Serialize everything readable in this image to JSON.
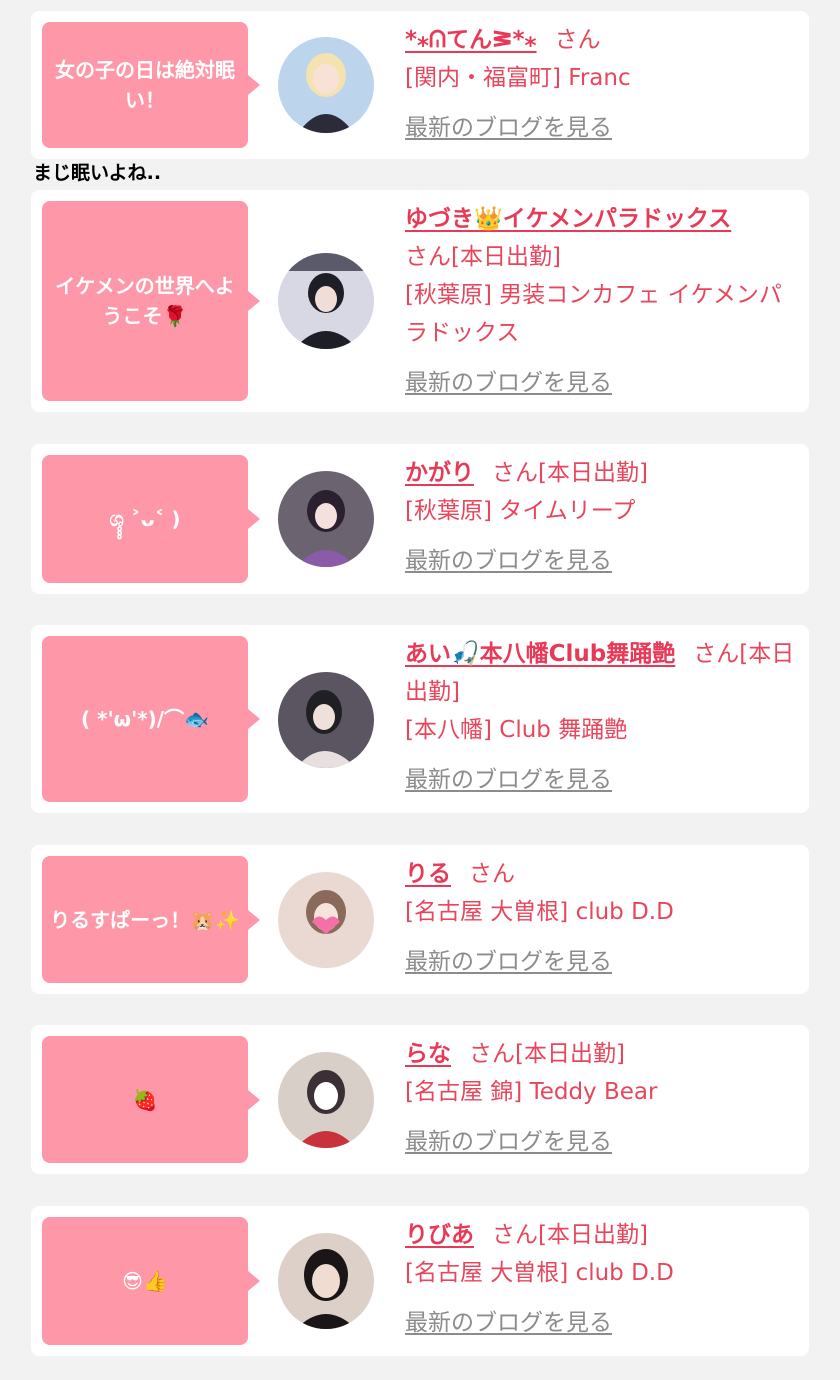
{
  "posts": [
    {
      "bubble": "女の子の日は絶対眠い！",
      "name": "*⁎ᕬてんᕒ*⁎",
      "suffix": "さん",
      "shop": "[関内・福富町] Franc",
      "blog_link": "最新のブログを見る",
      "avatar_colors": [
        "#bcd4ec",
        "#f4e3b0",
        "#2b2b3a"
      ]
    },
    {
      "bubble": "イケメンの世界へようこそ🌹",
      "name": "ゆづき👑イケメンパラドックス",
      "suffix": "さん[本日出勤]",
      "shop": "[秋葉原] 男装コンカフェ イケメンパラドックス",
      "blog_link": "最新のブログを見る",
      "avatar_colors": [
        "#1e1e26",
        "#d8d8e4",
        "#5a5a6a"
      ]
    },
    {
      "bubble": "ශ̥̥̥ ˃ᴗ˂ )",
      "name": "かがり",
      "suffix": "さん[本日出勤]",
      "shop": "[秋葉原] タイムリープ",
      "blog_link": "最新のブログを見る",
      "avatar_colors": [
        "#6b6470",
        "#2a2030",
        "#8b5aa8"
      ]
    },
    {
      "bubble": "( *'ω'*)/⌒🐟",
      "name": "あい🎣本八幡Club舞踊艶",
      "suffix": "さん[本日出勤]",
      "shop": "[本八幡] Club 舞踊艶",
      "blog_link": "最新のブログを見る",
      "avatar_colors": [
        "#5a5560",
        "#e8e0e0",
        "#202024"
      ]
    },
    {
      "bubble": "りるすぱーっ！🐹✨",
      "name": "りる",
      "suffix": "さん",
      "shop": "[名古屋 大曽根] club D.D",
      "blog_link": "最新のブログを見る",
      "avatar_colors": [
        "#e9d9d2",
        "#8a6a5a",
        "#f56fa8"
      ]
    },
    {
      "bubble": "🍓",
      "name": "らな",
      "suffix": "さん[本日出勤]",
      "shop": "[名古屋 錦] Teddy Bear",
      "blog_link": "最新のブログを見る",
      "avatar_colors": [
        "#d9cfc9",
        "#3a3036",
        "#c8323c"
      ]
    },
    {
      "bubble": "😎👍",
      "name": "りびあ",
      "suffix": "さん[本日出勤]",
      "shop": "[名古屋 大曽根] club D.D",
      "blog_link": "最新のブログを見る",
      "avatar_colors": [
        "#dcd0c8",
        "#1a1618",
        "#f0dcd0"
      ]
    }
  ],
  "note_text": "まじ眠いよね..",
  "colors": {
    "bubble": "#fe97a8",
    "accent": "#e83a57",
    "muted": "#8c8c8c",
    "background": "#f2f2f2"
  }
}
